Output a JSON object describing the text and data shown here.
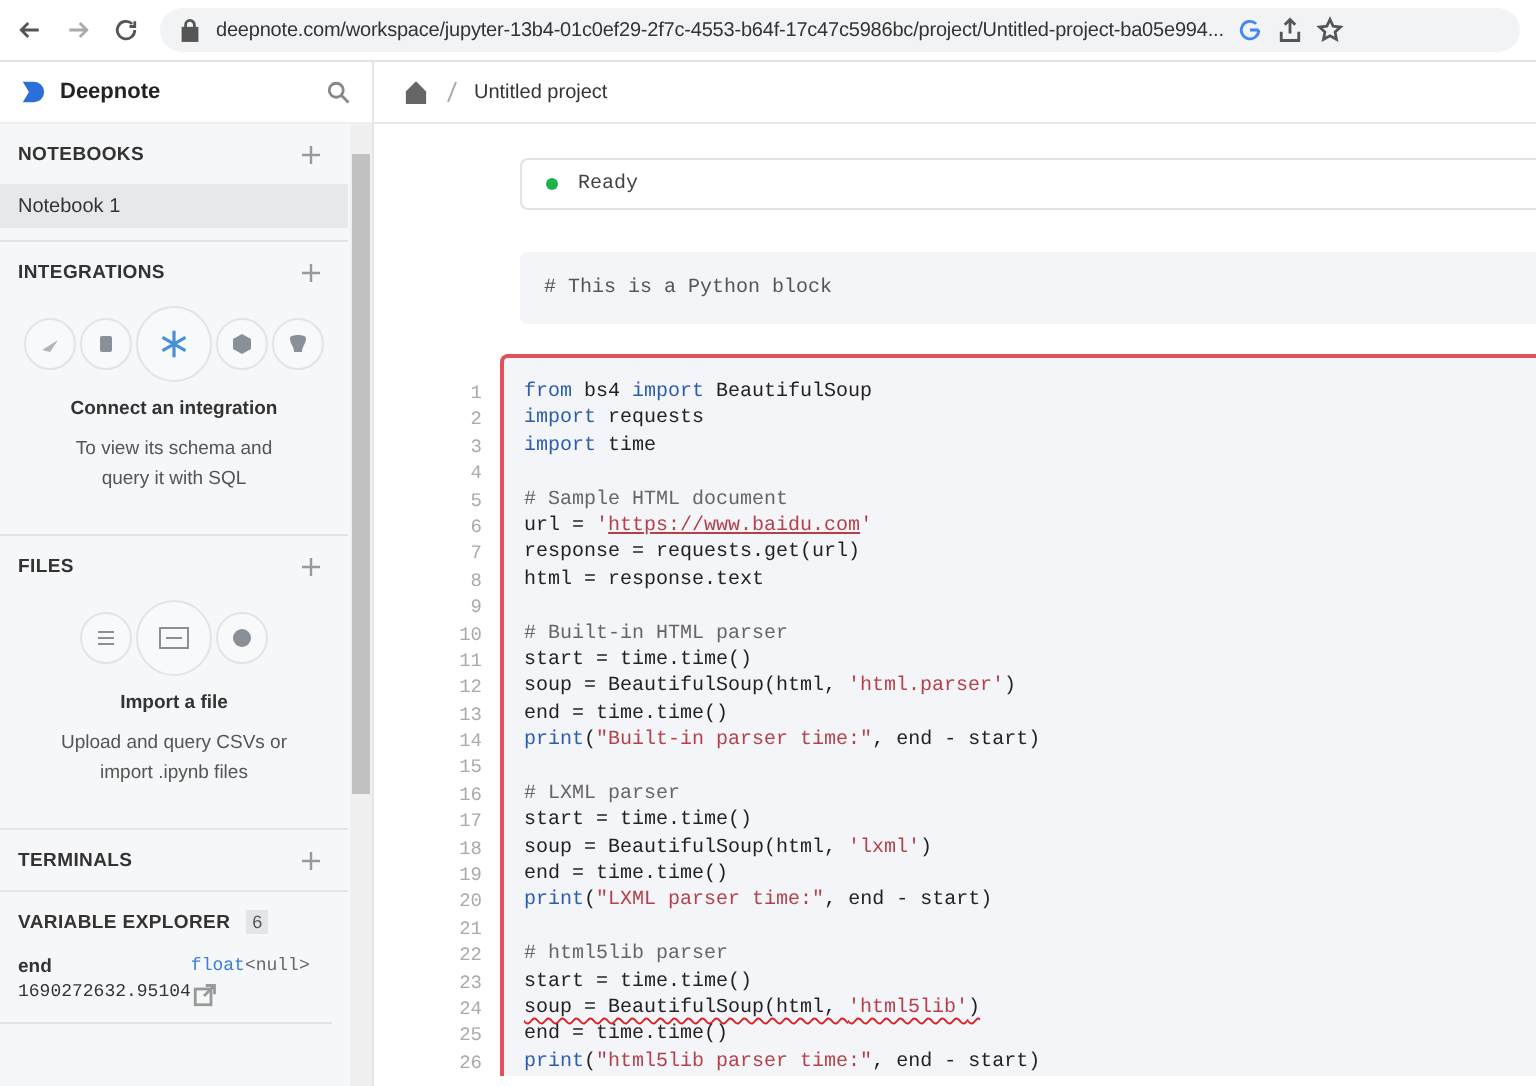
{
  "browser": {
    "url": "deepnote.com/workspace/jupyter-13b4-01c0ef29-2f7c-4553-b64f-17c47c5986bc/project/Untitled-project-ba05e994..."
  },
  "sidebar": {
    "brand": "Deepnote",
    "notebooks": {
      "title": "NOTEBOOKS",
      "items": [
        {
          "label": "Notebook 1",
          "selected": true
        }
      ]
    },
    "integrations": {
      "title": "INTEGRATIONS",
      "heading": "Connect an integration",
      "lines": [
        "To view its schema and",
        "query it with SQL"
      ]
    },
    "files": {
      "title": "FILES",
      "heading": "Import a file",
      "lines": [
        "Upload and query CSVs or",
        "import .ipynb files"
      ]
    },
    "terminals": {
      "title": "TERMINALS"
    },
    "variable_explorer": {
      "title": "VARIABLE EXPLORER",
      "count": "6",
      "variables": [
        {
          "name": "end",
          "type": "float",
          "shape": "<null>",
          "value": "1690272632.95104"
        }
      ]
    }
  },
  "breadcrumb": {
    "project": "Untitled project"
  },
  "status": {
    "label": "Ready"
  },
  "markdown_block": {
    "text": "# This is a Python block"
  },
  "code_block": {
    "selected": true,
    "lines": [
      {
        "number": "1",
        "error": false,
        "tokens": [
          {
            "kind": "keyword",
            "text": "from"
          },
          {
            "kind": "plain",
            "text": " bs4 "
          },
          {
            "kind": "keyword",
            "text": "import"
          },
          {
            "kind": "plain",
            "text": " BeautifulSoup"
          }
        ]
      },
      {
        "number": "2",
        "error": false,
        "tokens": [
          {
            "kind": "keyword",
            "text": "import"
          },
          {
            "kind": "plain",
            "text": " requests"
          }
        ]
      },
      {
        "number": "3",
        "error": false,
        "tokens": [
          {
            "kind": "keyword",
            "text": "import"
          },
          {
            "kind": "plain",
            "text": " time"
          }
        ]
      },
      {
        "number": "4"
      },
      {
        "number": "5",
        "error": false,
        "tokens": [
          {
            "kind": "comment",
            "text": "# Sample HTML document"
          }
        ]
      },
      {
        "number": "6",
        "error": false,
        "tokens": [
          {
            "kind": "plain",
            "text": "url = "
          },
          {
            "kind": "string",
            "text": "'"
          },
          {
            "kind": "link",
            "text": "https://www.baidu.com"
          },
          {
            "kind": "string",
            "text": "'"
          }
        ]
      },
      {
        "number": "7",
        "error": false,
        "tokens": [
          {
            "kind": "plain",
            "text": "response = requests.get(url)"
          }
        ]
      },
      {
        "number": "8",
        "error": false,
        "tokens": [
          {
            "kind": "plain",
            "text": "html = response.text"
          }
        ]
      },
      {
        "number": "9"
      },
      {
        "number": "10",
        "error": false,
        "tokens": [
          {
            "kind": "comment",
            "text": "# Built-in HTML parser"
          }
        ]
      },
      {
        "number": "11",
        "error": false,
        "tokens": [
          {
            "kind": "plain",
            "text": "start = time.time()"
          }
        ]
      },
      {
        "number": "12",
        "error": false,
        "tokens": [
          {
            "kind": "plain",
            "text": "soup = BeautifulSoup(html, "
          },
          {
            "kind": "string",
            "text": "'html.parser'"
          },
          {
            "kind": "plain",
            "text": ")"
          }
        ]
      },
      {
        "number": "13",
        "error": false,
        "tokens": [
          {
            "kind": "plain",
            "text": "end = time.time()"
          }
        ]
      },
      {
        "number": "14",
        "error": false,
        "tokens": [
          {
            "kind": "keyword",
            "text": "print"
          },
          {
            "kind": "plain",
            "text": "("
          },
          {
            "kind": "string",
            "text": "\"Built-in parser time:\""
          },
          {
            "kind": "plain",
            "text": ", end - start)"
          }
        ]
      },
      {
        "number": "15"
      },
      {
        "number": "16",
        "error": false,
        "tokens": [
          {
            "kind": "comment",
            "text": "# LXML parser"
          }
        ]
      },
      {
        "number": "17",
        "error": false,
        "tokens": [
          {
            "kind": "plain",
            "text": "start = time.time()"
          }
        ]
      },
      {
        "number": "18",
        "error": false,
        "tokens": [
          {
            "kind": "plain",
            "text": "soup = BeautifulSoup(html, "
          },
          {
            "kind": "string",
            "text": "'lxml'"
          },
          {
            "kind": "plain",
            "text": ")"
          }
        ]
      },
      {
        "number": "19",
        "error": false,
        "tokens": [
          {
            "kind": "plain",
            "text": "end = time.time()"
          }
        ]
      },
      {
        "number": "20",
        "error": false,
        "tokens": [
          {
            "kind": "keyword",
            "text": "print"
          },
          {
            "kind": "plain",
            "text": "("
          },
          {
            "kind": "string",
            "text": "\"LXML parser time:\""
          },
          {
            "kind": "plain",
            "text": ", end - start)"
          }
        ]
      },
      {
        "number": "21"
      },
      {
        "number": "22",
        "error": false,
        "tokens": [
          {
            "kind": "comment",
            "text": "# html5lib parser"
          }
        ]
      },
      {
        "number": "23",
        "error": false,
        "tokens": [
          {
            "kind": "plain",
            "text": "start = time.time()"
          }
        ]
      },
      {
        "number": "24",
        "error": true,
        "tokens": [
          {
            "kind": "plain",
            "text": "soup = BeautifulSoup(html, "
          },
          {
            "kind": "string",
            "text": "'html5lib'"
          },
          {
            "kind": "plain",
            "text": ")"
          }
        ]
      },
      {
        "number": "25",
        "error": false,
        "tokens": [
          {
            "kind": "plain",
            "text": "end = time.time()"
          }
        ]
      },
      {
        "number": "26",
        "error": false,
        "tokens": [
          {
            "kind": "keyword",
            "text": "print"
          },
          {
            "kind": "plain",
            "text": "("
          },
          {
            "kind": "string",
            "text": "\"html5lib parser time:\""
          },
          {
            "kind": "plain",
            "text": ", end - start)"
          }
        ]
      }
    ]
  }
}
